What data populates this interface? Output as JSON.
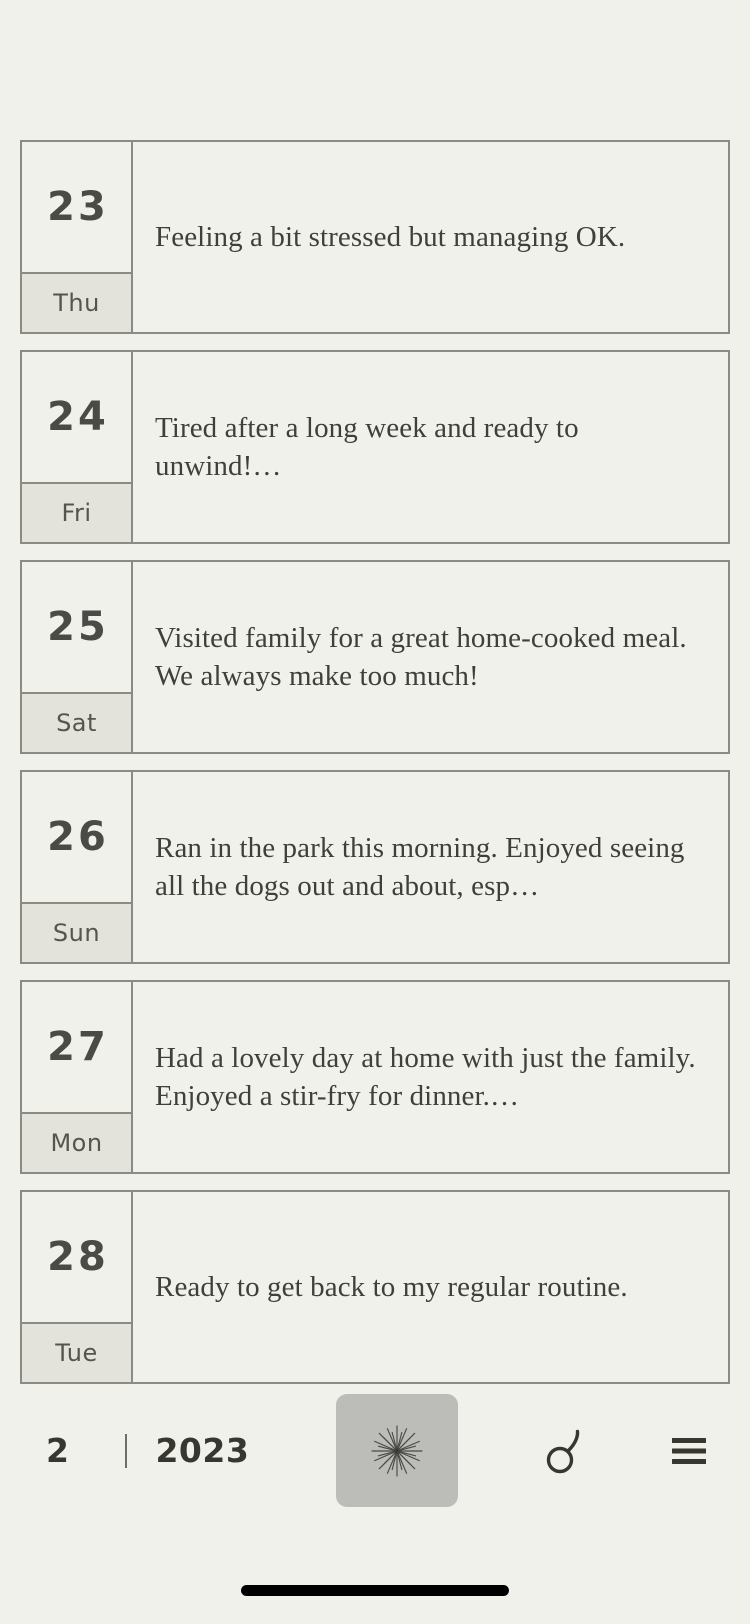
{
  "theme": {
    "background": "#f1f1ec",
    "card_background": "#f1f1ec",
    "border": "#8b8b83",
    "weekday_cell": "#e3e3dc",
    "text_primary": "#3f3f3c",
    "date_number": "#4a4a46",
    "nav_text": "#37372f",
    "active_button": "#bcbcb9",
    "home_indicator": "#000000"
  },
  "entries": [
    {
      "day": "23",
      "weekday": "Thu",
      "text": "Feeling a bit stressed but managing OK."
    },
    {
      "day": "24",
      "weekday": "Fri",
      "text": "Tired after a long week and ready to unwind!…"
    },
    {
      "day": "25",
      "weekday": "Sat",
      "text": "Visited family for a great home-cooked meal. We always make too much!"
    },
    {
      "day": "26",
      "weekday": "Sun",
      "text": "Ran in the park this morning. Enjoyed seeing all the dogs out and about, esp…"
    },
    {
      "day": "27",
      "weekday": "Mon",
      "text": "Had a lovely day at home with just the family. Enjoyed a stir-fry for dinner.…"
    },
    {
      "day": "28",
      "weekday": "Tue",
      "text": "Ready to get back to my regular routine."
    }
  ],
  "bottom_nav": {
    "month": "2",
    "year": "2023",
    "sparkle_icon": "sparkle-icon",
    "mars_icon": "mars-icon",
    "menu_icon": "hamburger-menu-icon"
  }
}
